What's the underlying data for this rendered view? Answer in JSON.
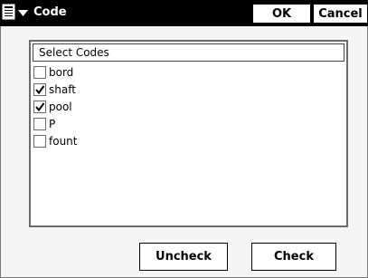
{
  "titlebar": {
    "title": "Code",
    "menu_icon": "document-menu-icon",
    "ok_label": "OK",
    "cancel_label": "Cancel"
  },
  "list": {
    "header": "Select Codes",
    "items": [
      {
        "label": "bord",
        "checked": false
      },
      {
        "label": "shaft",
        "checked": true
      },
      {
        "label": "pool",
        "checked": true
      },
      {
        "label": "P",
        "checked": false
      },
      {
        "label": "fount",
        "checked": false
      }
    ]
  },
  "buttons": {
    "uncheck_label": "Uncheck",
    "check_label": "Check"
  },
  "colors": {
    "titlebar_bg": "#000000",
    "title_text": "#ffffff",
    "border": "#6b6b6b"
  }
}
